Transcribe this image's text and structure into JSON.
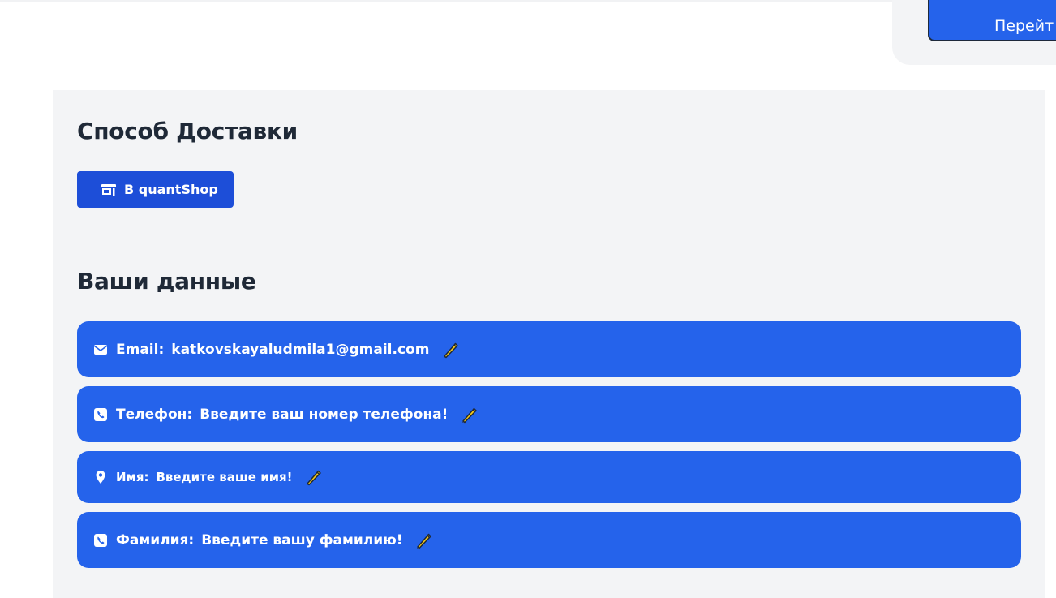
{
  "header": {
    "go_button_label": "Перейт"
  },
  "delivery": {
    "title": "Способ Доставки",
    "option_label": "В quantShop",
    "option_icon": "store-icon"
  },
  "user_data": {
    "title": "Ваши данные",
    "fields": [
      {
        "label": "Email:",
        "value": "katkovskayaludmila1@gmail.com",
        "icon": "envelope-icon"
      },
      {
        "label": "Телефон:",
        "value": "Введите ваш номер телефона!",
        "icon": "phone-square-icon"
      },
      {
        "label": "Имя:",
        "value": "Введите ваше имя!",
        "icon": "map-pin-icon"
      },
      {
        "label": "Фамилия:",
        "value": "Введите вашу фамилию!",
        "icon": "phone-square-icon"
      }
    ],
    "edit_icon": "pencil-icon"
  },
  "colors": {
    "accent": "#2563eb",
    "accent_dark": "#1d4ed8",
    "panel_bg": "#f3f4f6",
    "pencil_body": "#facc15"
  }
}
